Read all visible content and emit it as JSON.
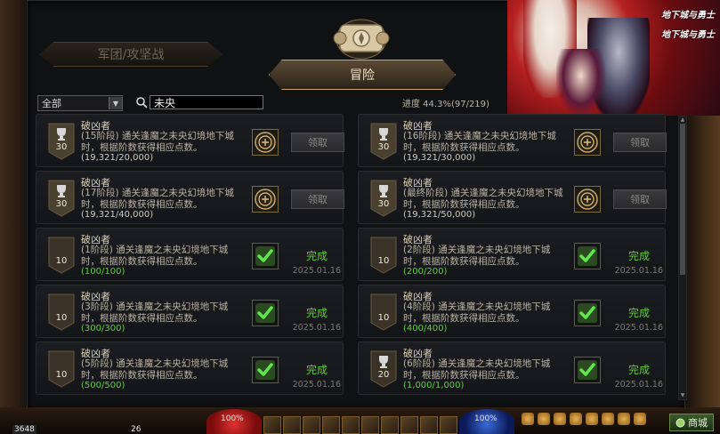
{
  "tabs": {
    "guild": "军团/攻坚战",
    "adventure": "冒险"
  },
  "filter": {
    "selected": "全部",
    "search_value": "未央"
  },
  "progress": "进度 44.3%(97/219)",
  "banner": {
    "logo_top": "地下城与勇士",
    "logo_bottom": "地下城与勇士"
  },
  "claim_label": "领取",
  "done_label": "完成",
  "cards": [
    {
      "badge": "30",
      "title": "破凶者",
      "desc": "(15阶段) 通关逢魔之未央幻境地下城时，根据阶数获得相应点数。",
      "progress": "(19,321/20,000)",
      "done": false,
      "date": ""
    },
    {
      "badge": "30",
      "title": "破凶者",
      "desc": "(16阶段) 通关逢魔之未央幻境地下城时，根据阶数获得相应点数。",
      "progress": "(19,321/30,000)",
      "done": false,
      "date": ""
    },
    {
      "badge": "30",
      "title": "破凶者",
      "desc": "(17阶段) 通关逢魔之未央幻境地下城时，根据阶数获得相应点数。",
      "progress": "(19,321/40,000)",
      "done": false,
      "date": ""
    },
    {
      "badge": "30",
      "title": "破凶者",
      "desc": "(最终阶段) 通关逢魔之未央幻境地下城时，根据阶数获得相应点数。",
      "progress": "(19,321/50,000)",
      "done": false,
      "date": ""
    },
    {
      "badge": "10",
      "title": "破凶者",
      "desc": "(1阶段) 通关逢魔之未央幻境地下城时，根据阶数获得相应点数。",
      "progress": "(100/100)",
      "done": true,
      "date": "2025.01.16"
    },
    {
      "badge": "10",
      "title": "破凶者",
      "desc": "(2阶段) 通关逢魔之未央幻境地下城时，根据阶数获得相应点数。",
      "progress": "(200/200)",
      "done": true,
      "date": "2025.01.16"
    },
    {
      "badge": "10",
      "title": "破凶者",
      "desc": "(3阶段) 通关逢魔之未央幻境地下城时，根据阶数获得相应点数。",
      "progress": "(300/300)",
      "done": true,
      "date": "2025.01.16"
    },
    {
      "badge": "10",
      "title": "破凶者",
      "desc": "(4阶段) 通关逢魔之未央幻境地下城时，根据阶数获得相应点数。",
      "progress": "(400/400)",
      "done": true,
      "date": "2025.01.16"
    },
    {
      "badge": "10",
      "title": "破凶者",
      "desc": "(5阶段) 通关逢魔之未央幻境地下城时，根据阶数获得相应点数。",
      "progress": "(500/500)",
      "done": true,
      "date": "2025.01.16"
    },
    {
      "badge": "20",
      "title": "破凶者",
      "desc": "(6阶段) 通关逢魔之未央幻境地下城时，根据阶数获得相应点数。",
      "progress": "(1,000/1,000)",
      "done": true,
      "date": "2025.01.16"
    }
  ],
  "hud": {
    "hp": "100%",
    "mp": "100%",
    "level": "3648",
    "level2": "26",
    "shop": "商城"
  }
}
